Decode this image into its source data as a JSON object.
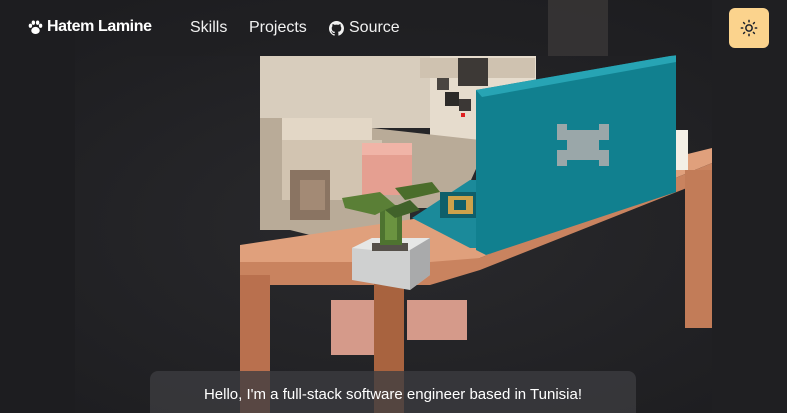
{
  "navbar": {
    "logo_text": "Hatem Lamine",
    "links": [
      {
        "label": "Skills"
      },
      {
        "label": "Projects"
      },
      {
        "label": "Source"
      }
    ],
    "theme_icon": "sun-icon"
  },
  "greeting": {
    "text": "Hello, I'm a full-stack software engineer based in Tunisia!"
  },
  "colors": {
    "background": "#202023",
    "theme_button": "#fbd38d",
    "laptop": "#1a7f8c",
    "desk": "#d9956f"
  }
}
